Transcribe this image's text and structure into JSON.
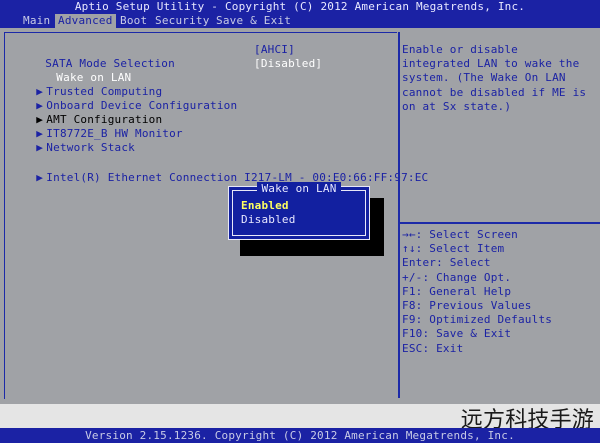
{
  "title": "Aptio Setup Utility - Copyright (C) 2012 American Megatrends, Inc.",
  "menu": [
    "Main",
    "Advanced",
    "Boot",
    "Security",
    "Save & Exit"
  ],
  "settings": {
    "sata": {
      "label": "SATA Mode Selection",
      "value": "[AHCI]"
    },
    "wol": {
      "label": "Wake on LAN",
      "value": "[Disabled]"
    },
    "items": [
      "Trusted Computing",
      "Onboard Device Configuration",
      "AMT Configuration",
      "IT8772E_B HW Monitor",
      "Network Stack"
    ],
    "intel": "Intel(R) Ethernet Connection I217-LM - 00:E0:66:FF:97:EC"
  },
  "help": {
    "description": "Enable or disable integrated LAN to wake the system. (The Wake On LAN cannot be disabled if ME is on at Sx state.)",
    "keys": [
      "→←: Select Screen",
      "↑↓: Select Item",
      "Enter: Select",
      "+/-: Change Opt.",
      "F1: General Help",
      "F8: Previous Values",
      "F9: Optimized Defaults",
      "F10: Save & Exit",
      "ESC: Exit"
    ]
  },
  "popup": {
    "title": "Wake on LAN",
    "options": [
      "Enabled",
      "Disabled"
    ]
  },
  "status": "Version 2.15.1236. Copyright (C) 2012 American Megatrends, Inc.",
  "watermark": "远方科技手游",
  "colors": {
    "bios_blue": "#1b22a4",
    "background": "#a0a2a6",
    "highlight": "#ffff60"
  },
  "icons": {
    "submenu": "triangle-right-icon"
  }
}
